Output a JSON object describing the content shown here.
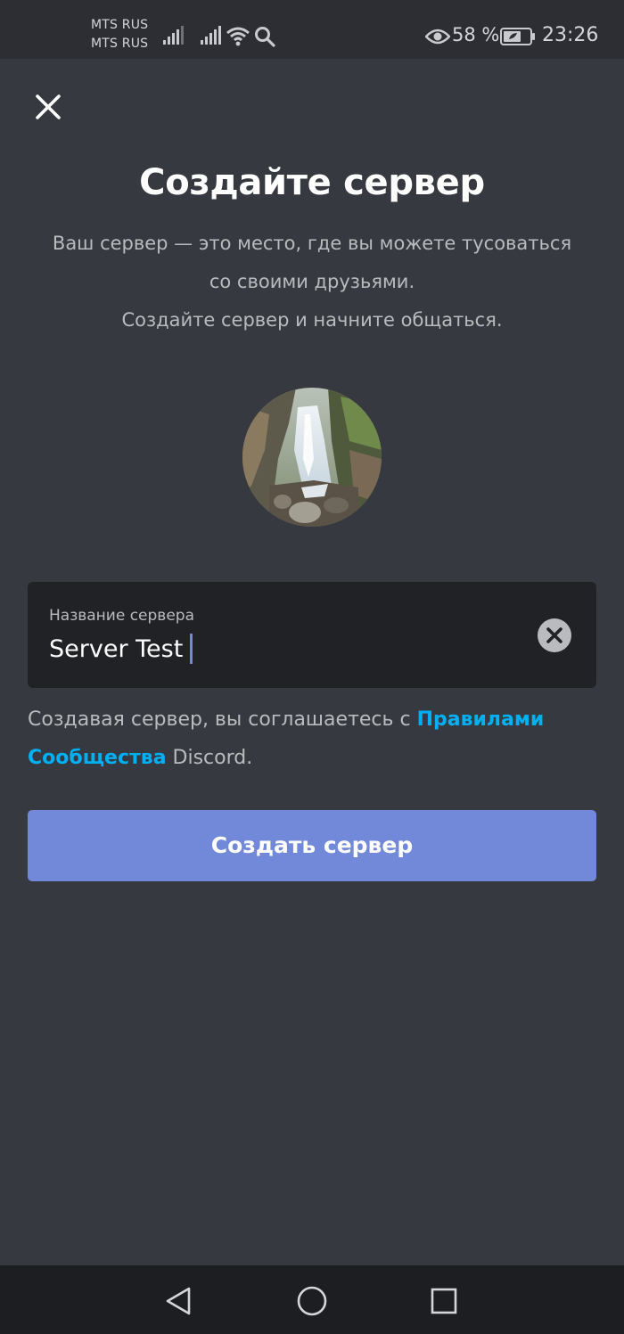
{
  "status_bar": {
    "carrier_1": "MTS RUS",
    "carrier_2": "MTS RUS",
    "battery_percent": "58 %",
    "time": "23:26",
    "icons": [
      "signal-icon",
      "signal-icon",
      "wifi-icon",
      "search-icon",
      "eye-icon",
      "battery-icon"
    ]
  },
  "header": {
    "title": "Создайте сервер",
    "subtitle_line_1": "Ваш сервер — это место, где вы можете тусоваться",
    "subtitle_line_2": "со своими друзьями.",
    "subtitle_line_3": "Создайте сервер и начните общаться."
  },
  "server_icon": {
    "alt": "waterfall-photo"
  },
  "server_name_field": {
    "label": "Название сервера",
    "value": "Server Test"
  },
  "terms": {
    "prefix": "Создавая сервер, вы соглашаетесь с ",
    "link_text": "Правилами Сообщества",
    "suffix": " Discord."
  },
  "create_button": {
    "label": "Создать сервер"
  },
  "colors": {
    "background": "#36393f",
    "input_background": "#202225",
    "accent": "#7289da",
    "link": "#00b0f4"
  }
}
